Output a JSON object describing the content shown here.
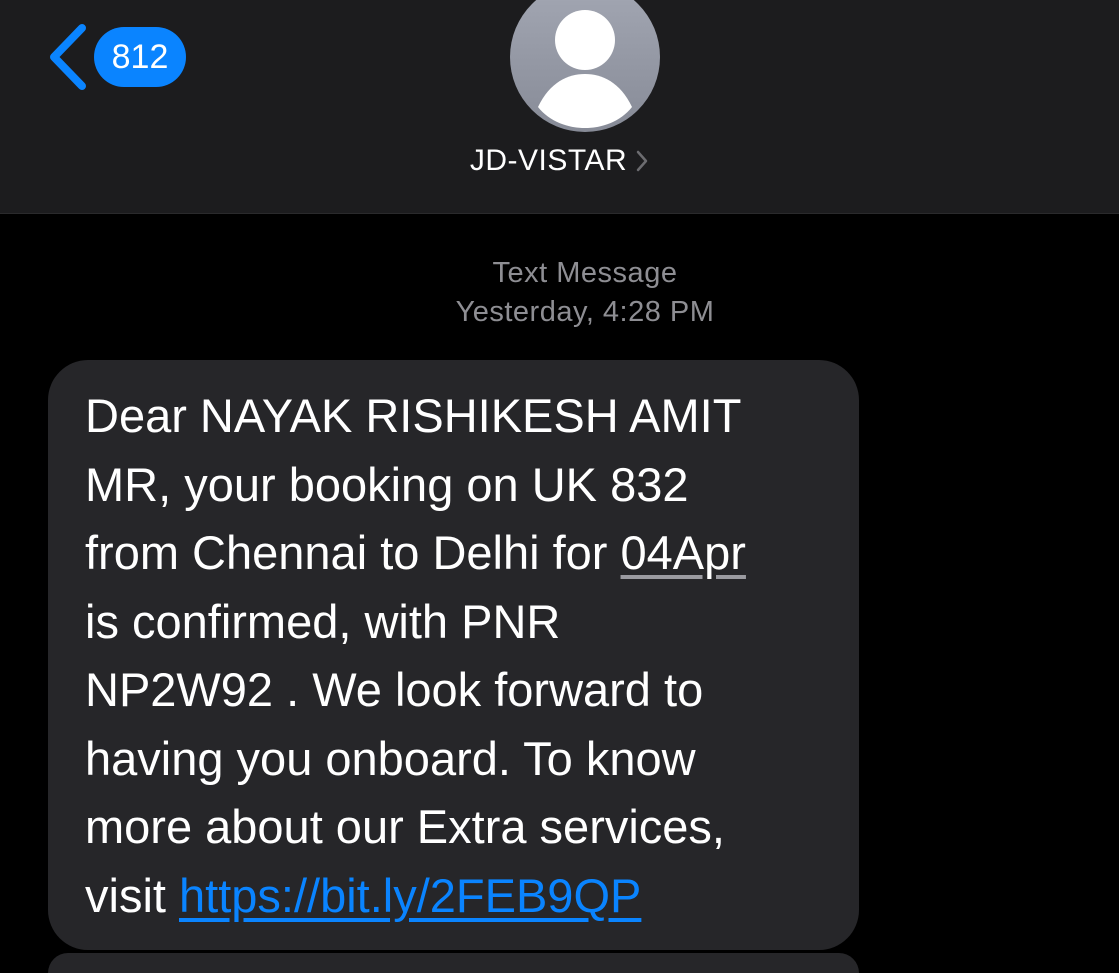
{
  "header": {
    "unread_count": "812",
    "contact_name": "JD-VISTAR",
    "avatar_icon": "person-silhouette-icon",
    "back_icon": "chevron-left-icon",
    "accent_color": "#0a84ff"
  },
  "thread": {
    "message_type": "Text Message",
    "timestamp": "Yesterday, 4:28 PM"
  },
  "message": {
    "line1": "Dear NAYAK RISHIKESH AMIT",
    "line2": "MR, your booking on UK 832",
    "line3_pre": "from Chennai to Delhi for ",
    "line3_date": "04Apr",
    "line4": "is confirmed, with PNR",
    "line5": "NP2W92 . We look forward to",
    "line6": "having you onboard. To know",
    "line7": "more about our Extra services,",
    "line8_pre": "visit ",
    "link_url": "https://bit.ly/2FEB9QP"
  }
}
